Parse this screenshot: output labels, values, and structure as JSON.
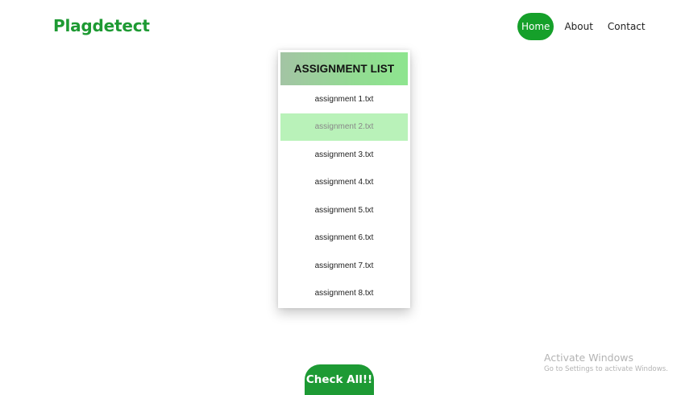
{
  "brand": {
    "name": "Plagdetect",
    "color": "#1e9a33"
  },
  "nav": {
    "items": [
      {
        "label": "Home",
        "active": true
      },
      {
        "label": "About",
        "active": false
      },
      {
        "label": "Contact",
        "active": false
      }
    ],
    "active_color": "#15a02a"
  },
  "assignment_list": {
    "title": "ASSIGNMENT LIST",
    "items": [
      {
        "label": "assignment 1.txt",
        "selected": false
      },
      {
        "label": "assignment 2.txt",
        "selected": true
      },
      {
        "label": "assignment 3.txt",
        "selected": false
      },
      {
        "label": "assignment 4.txt",
        "selected": false
      },
      {
        "label": "assignment 5.txt",
        "selected": false
      },
      {
        "label": "assignment 6.txt",
        "selected": false
      },
      {
        "label": "assignment 7.txt",
        "selected": false
      },
      {
        "label": "assignment 8.txt",
        "selected": false
      }
    ],
    "selected_color": "#b9f2b9"
  },
  "actions": {
    "check_all_label": "Check All!!",
    "button_color": "#1d9a34"
  },
  "watermark": {
    "title": "Activate Windows",
    "subtitle": "Go to Settings to activate Windows."
  }
}
